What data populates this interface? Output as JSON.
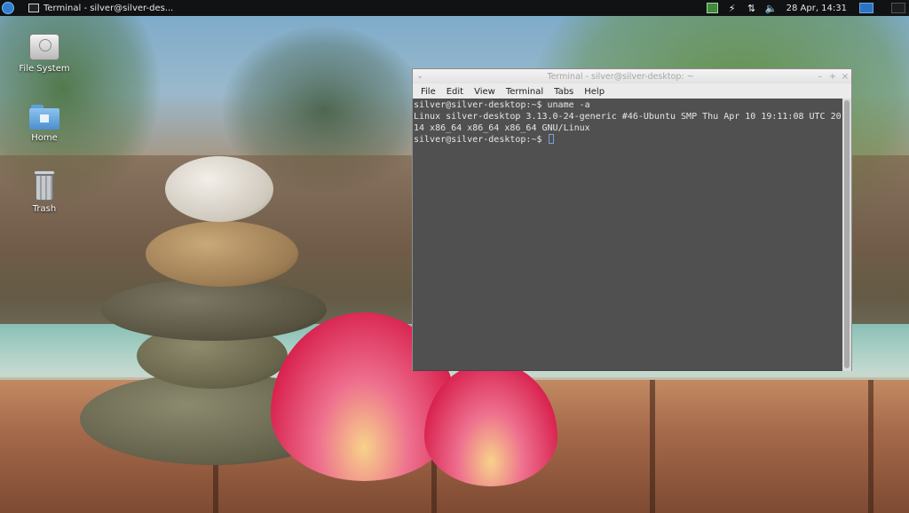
{
  "panel": {
    "taskbar_label": "Terminal - silver@silver-des...",
    "clock": "28 Apr, 14:31",
    "tray_icons": [
      "network-icon",
      "power-icon",
      "transfer-icon",
      "volume-icon"
    ]
  },
  "desktop": {
    "icons": [
      {
        "label": "File System",
        "icon": "drive-icon"
      },
      {
        "label": "Home",
        "icon": "home-folder-icon"
      },
      {
        "label": "Trash",
        "icon": "trash-icon"
      }
    ]
  },
  "terminal": {
    "title": "Terminal - silver@silver-desktop: ~",
    "menu": [
      "File",
      "Edit",
      "View",
      "Terminal",
      "Tabs",
      "Help"
    ],
    "lines": [
      "silver@silver-desktop:~$ uname -a",
      "Linux silver-desktop 3.13.0-24-generic #46-Ubuntu SMP Thu Apr 10 19:11:08 UTC 20",
      "14 x86_64 x86_64 x86_64 GNU/Linux"
    ],
    "prompt": "silver@silver-desktop:~$ "
  },
  "colors": {
    "panel_bg": "#101214",
    "terminal_bg": "#3a3a3a",
    "workspace_active": "#2a74c4"
  }
}
